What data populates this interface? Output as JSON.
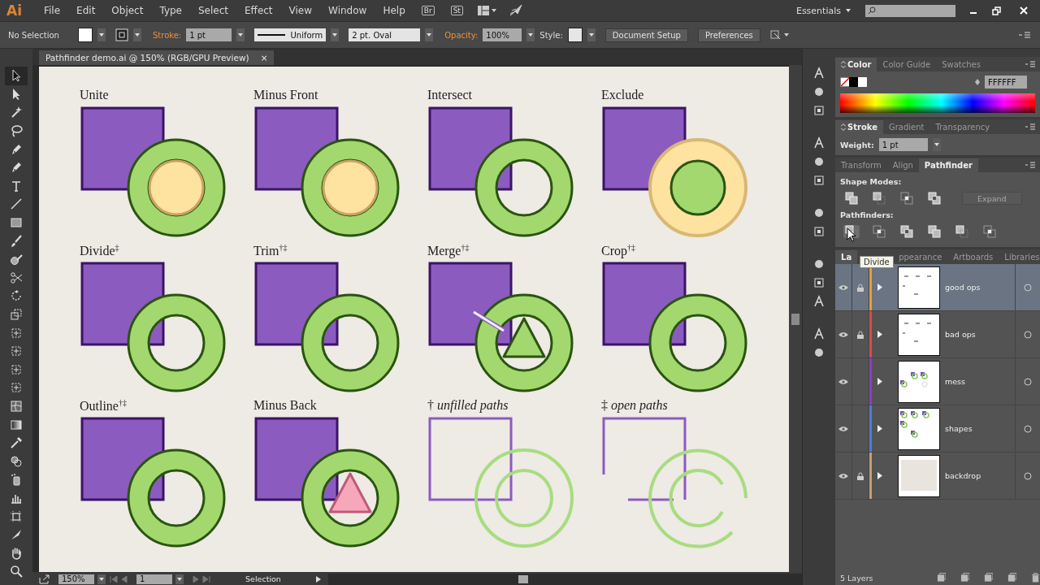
{
  "app": {
    "logo": "Ai",
    "menus": [
      "File",
      "Edit",
      "Object",
      "Type",
      "Select",
      "Effect",
      "View",
      "Window",
      "Help"
    ],
    "bridge": "Br",
    "stock": "St",
    "workspace": "Essentials"
  },
  "control_bar": {
    "selection": "No Selection",
    "stroke_label": "Stroke:",
    "stroke_weight": "1 pt",
    "stroke_profile": "Uniform",
    "brush": "2 pt. Oval",
    "opacity_label": "Opacity:",
    "opacity": "100%",
    "style_label": "Style:",
    "buttons": [
      "Document Setup",
      "Preferences"
    ]
  },
  "document_tab": {
    "title": "Pathfinder demo.ai @ 150% (RGB/GPU Preview)",
    "close": "×"
  },
  "tools": [
    {
      "kind": "selection",
      "selected": true
    },
    {
      "kind": "direct",
      "selected": false
    },
    {
      "kind": "wand",
      "selected": false
    },
    {
      "kind": "lasso",
      "selected": false
    },
    {
      "kind": "pen",
      "selected": false
    },
    {
      "kind": "curvature",
      "selected": false
    },
    {
      "kind": "type",
      "selected": false
    },
    {
      "kind": "line",
      "selected": false
    },
    {
      "kind": "rectangle",
      "selected": false
    },
    {
      "kind": "brush",
      "selected": false
    },
    {
      "kind": "blob",
      "selected": false
    },
    {
      "kind": "scissors",
      "selected": false
    },
    {
      "kind": "rotate",
      "selected": false
    },
    {
      "kind": "scale",
      "selected": false
    },
    {
      "kind": "warp",
      "selected": false
    },
    {
      "kind": "free_transform",
      "selected": false
    },
    {
      "kind": "shape_builder",
      "selected": false
    },
    {
      "kind": "perspective",
      "selected": false
    },
    {
      "kind": "mesh",
      "selected": false
    },
    {
      "kind": "gradient",
      "selected": false
    },
    {
      "kind": "eyedropper",
      "selected": false
    },
    {
      "kind": "blend",
      "selected": false
    },
    {
      "kind": "symbol",
      "selected": false
    },
    {
      "kind": "graph",
      "selected": false
    },
    {
      "kind": "artboard",
      "selected": false
    },
    {
      "kind": "slice",
      "selected": false
    },
    {
      "kind": "hand",
      "selected": false
    },
    {
      "kind": "zoom",
      "selected": false
    }
  ],
  "artboard": {
    "cells": [
      {
        "title": "Unite",
        "kind": "unite"
      },
      {
        "title": "Minus Front",
        "kind": "minus_front"
      },
      {
        "title": "Intersect",
        "kind": "intersect"
      },
      {
        "title": "Exclude",
        "kind": "exclude"
      },
      {
        "title": "Divide$^{‡}$",
        "kind": "divide"
      },
      {
        "title": "Trim$^{†‡}$",
        "kind": "trim"
      },
      {
        "title": "Merge$^{†‡}$",
        "kind": "merge"
      },
      {
        "title": "Crop$^{†‡}$",
        "kind": "crop"
      },
      {
        "title": "Outline$^{†‡}$",
        "kind": "outline"
      },
      {
        "title": "Minus Back",
        "kind": "minus_back"
      },
      {
        "title": "† *unfilled paths*",
        "kind": "unfilled"
      },
      {
        "title": "‡ *open paths*",
        "kind": "open"
      }
    ]
  },
  "status_bar": {
    "zoom": "150%",
    "artboard": "1",
    "tool": "Selection"
  },
  "panels": {
    "color": {
      "tabs": [
        {
          "label": "Color",
          "selected": true
        },
        {
          "label": "Color Guide",
          "selected": false
        },
        {
          "label": "Swatches",
          "selected": false
        }
      ],
      "hex": "FFFFFF"
    },
    "stroke": {
      "tabs": [
        {
          "label": "Stroke",
          "selected": true
        },
        {
          "label": "Gradient",
          "selected": false
        },
        {
          "label": "Transparency",
          "selected": false
        }
      ],
      "weight_label": "Weight:",
      "weight": "1 pt"
    },
    "pathfinder": {
      "tabs": [
        {
          "label": "Transform",
          "selected": false
        },
        {
          "label": "Align",
          "selected": false
        },
        {
          "label": "Pathfinder",
          "selected": true
        }
      ],
      "shape_modes_label": "Shape Modes:",
      "expand": {
        "label": "Expand",
        "disabled": true
      },
      "pathfinders_label": "Pathfinders:",
      "pathfinders": [
        {
          "hovered": true
        },
        {
          "hovered": false
        },
        {
          "hovered": false
        },
        {
          "hovered": false
        },
        {
          "hovered": false
        },
        {
          "hovered": false
        }
      ]
    },
    "layers": {
      "tabs": [
        {
          "label": "La",
          "selected": true
        },
        {
          "label": "ppearance",
          "selected": false
        },
        {
          "label": "Artboards",
          "selected": false
        },
        {
          "label": "Libraries",
          "selected": false
        }
      ],
      "tooltip": "Divide",
      "count": "5 Layers",
      "layers": [
        {
          "name": "good ops",
          "color": "#e8a030",
          "locked": true,
          "selected": true,
          "kind": "dashes"
        },
        {
          "name": "bad ops",
          "color": "#e04848",
          "locked": true,
          "selected": false,
          "kind": "dashes"
        },
        {
          "name": "mess",
          "color": "#8a3cd0",
          "locked": false,
          "selected": false,
          "kind": "mess"
        },
        {
          "name": "shapes",
          "color": "#4a7ee0",
          "locked": false,
          "selected": false,
          "kind": "shapes"
        },
        {
          "name": "backdrop",
          "color": "#c8a070",
          "locked": true,
          "selected": false,
          "kind": "backdrop"
        }
      ]
    }
  }
}
